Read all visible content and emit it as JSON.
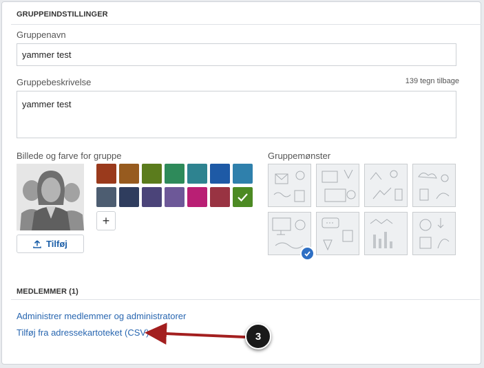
{
  "group_settings": {
    "title": "GRUPPEINDSTILLINGER",
    "name_label": "Gruppenavn",
    "name_value": "yammer test",
    "description_label": "Gruppebeskrivelse",
    "description_counter": "139 tegn tilbage",
    "description_value": "yammer test",
    "image_color_label": "Billede og farve for gruppe",
    "upload_label": "Tilføj",
    "add_color_symbol": "+",
    "pattern_label": "Gruppemønster",
    "colors": [
      "#9a3a1c",
      "#975b1f",
      "#5b7c1d",
      "#2e8a5a",
      "#2e8390",
      "#1e5aa6",
      "#2f80ac",
      "#4d5d71",
      "#2f3d5e",
      "#4b4479",
      "#6d5898",
      "#b91f74",
      "#993342",
      "#4c8a23"
    ],
    "selected_color": "#4c8a23",
    "selected_pattern": 5,
    "icons": {
      "upload": "upload-icon",
      "check": "check-icon",
      "add": "plus-icon"
    }
  },
  "members": {
    "title": "MEDLEMMER (1)",
    "manage_link": "Administrer medlemmer og administratorer",
    "csv_link": "Tilføj fra adressekartoteket (CSV)"
  },
  "annotation": {
    "step_number": "3",
    "arrow_color": "#a31f1f"
  }
}
